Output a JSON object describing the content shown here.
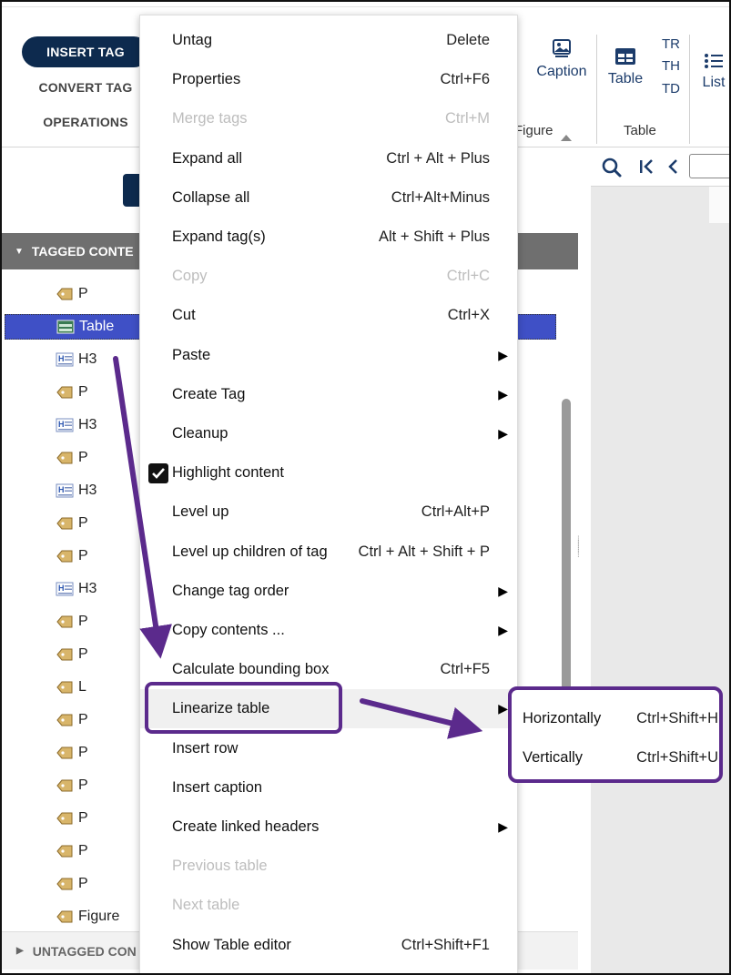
{
  "ribbon": {
    "tabs": [
      {
        "label": "INSERT TAG",
        "active": true
      },
      {
        "label": "CONVERT TAG",
        "active": false
      },
      {
        "label": "OPERATIONS",
        "active": false
      }
    ],
    "caption_label": "Caption",
    "table_label": "Table",
    "tr_label": "TR",
    "th_label": "TH",
    "td_label": "TD",
    "list_label": "List",
    "group_figure": "Figure",
    "group_table": "Table"
  },
  "left_panel": {
    "tagged_header": "TAGGED CONTE",
    "untagged_header": "UNTAGGED CON",
    "tree": [
      {
        "label": "P",
        "icon": "tag-icon",
        "selected": false
      },
      {
        "label": "Table",
        "icon": "table-tag-icon",
        "selected": true
      },
      {
        "label": "H3",
        "icon": "heading-icon",
        "selected": false
      },
      {
        "label": "P",
        "icon": "tag-icon",
        "selected": false
      },
      {
        "label": "H3",
        "icon": "heading-icon",
        "selected": false
      },
      {
        "label": "P",
        "icon": "tag-icon",
        "selected": false
      },
      {
        "label": "H3",
        "icon": "heading-icon",
        "selected": false
      },
      {
        "label": "P",
        "icon": "tag-icon",
        "selected": false
      },
      {
        "label": "P",
        "icon": "tag-icon",
        "selected": false
      },
      {
        "label": "H3",
        "icon": "heading-icon",
        "selected": false
      },
      {
        "label": "P",
        "icon": "tag-icon",
        "selected": false
      },
      {
        "label": "P",
        "icon": "tag-icon",
        "selected": false
      },
      {
        "label": "L",
        "icon": "tag-icon",
        "selected": false
      },
      {
        "label": "P",
        "icon": "tag-icon",
        "selected": false
      },
      {
        "label": "P",
        "icon": "tag-icon",
        "selected": false
      },
      {
        "label": "P",
        "icon": "tag-icon",
        "selected": false
      },
      {
        "label": "P",
        "icon": "tag-icon",
        "selected": false
      },
      {
        "label": "P",
        "icon": "tag-icon",
        "selected": false
      },
      {
        "label": "P",
        "icon": "tag-icon",
        "selected": false
      },
      {
        "label": "Figure",
        "icon": "tag-icon",
        "selected": false
      }
    ]
  },
  "context_menu": {
    "items": [
      {
        "label": "Untag",
        "shortcut": "Delete",
        "submenu": false,
        "disabled": false
      },
      {
        "label": "Properties",
        "shortcut": "Ctrl+F6",
        "submenu": false,
        "disabled": false
      },
      {
        "label": "Merge tags",
        "shortcut": "Ctrl+M",
        "submenu": false,
        "disabled": true
      },
      {
        "label": "Expand all",
        "shortcut": "Ctrl + Alt + Plus",
        "submenu": false,
        "disabled": false
      },
      {
        "label": "Collapse all",
        "shortcut": "Ctrl+Alt+Minus",
        "submenu": false,
        "disabled": false
      },
      {
        "label": "Expand tag(s)",
        "shortcut": "Alt + Shift + Plus",
        "submenu": false,
        "disabled": false
      },
      {
        "label": "Copy",
        "shortcut": "Ctrl+C",
        "submenu": false,
        "disabled": true
      },
      {
        "label": "Cut",
        "shortcut": "Ctrl+X",
        "submenu": false,
        "disabled": false
      },
      {
        "label": "Paste",
        "shortcut": "",
        "submenu": true,
        "disabled": false
      },
      {
        "label": "Create Tag",
        "shortcut": "",
        "submenu": true,
        "disabled": false
      },
      {
        "label": "Cleanup",
        "shortcut": "",
        "submenu": true,
        "disabled": false
      },
      {
        "label": "Highlight content",
        "shortcut": "",
        "submenu": false,
        "disabled": false,
        "checked": true
      },
      {
        "label": "Level up",
        "shortcut": "Ctrl+Alt+P",
        "submenu": false,
        "disabled": false
      },
      {
        "label": "Level up children of tag",
        "shortcut": "Ctrl + Alt + Shift + P",
        "submenu": false,
        "disabled": false
      },
      {
        "label": "Change tag order",
        "shortcut": "",
        "submenu": true,
        "disabled": false
      },
      {
        "label": "Copy contents ...",
        "shortcut": "",
        "submenu": true,
        "disabled": false
      },
      {
        "label": "Calculate bounding box",
        "shortcut": "Ctrl+F5",
        "submenu": false,
        "disabled": false
      },
      {
        "label": "Linearize table",
        "shortcut": "",
        "submenu": true,
        "disabled": false,
        "hovered": true
      },
      {
        "label": "Insert row",
        "shortcut": "",
        "submenu": false,
        "disabled": false
      },
      {
        "label": "Insert caption",
        "shortcut": "",
        "submenu": false,
        "disabled": false
      },
      {
        "label": "Create linked headers",
        "shortcut": "",
        "submenu": true,
        "disabled": false
      },
      {
        "label": "Previous table",
        "shortcut": "",
        "submenu": false,
        "disabled": true
      },
      {
        "label": "Next table",
        "shortcut": "",
        "submenu": false,
        "disabled": true
      },
      {
        "label": "Show Table editor",
        "shortcut": "Ctrl+Shift+F1",
        "submenu": false,
        "disabled": false
      }
    ]
  },
  "submenu": {
    "items": [
      {
        "label": "Horizontally",
        "shortcut": "Ctrl+Shift+H"
      },
      {
        "label": "Vertically",
        "shortcut": "Ctrl+Shift+U"
      }
    ]
  },
  "colors": {
    "brand_navy": "#0d2a4e",
    "selection": "#3f50c6",
    "annotation_purple": "#5b2a8c"
  }
}
